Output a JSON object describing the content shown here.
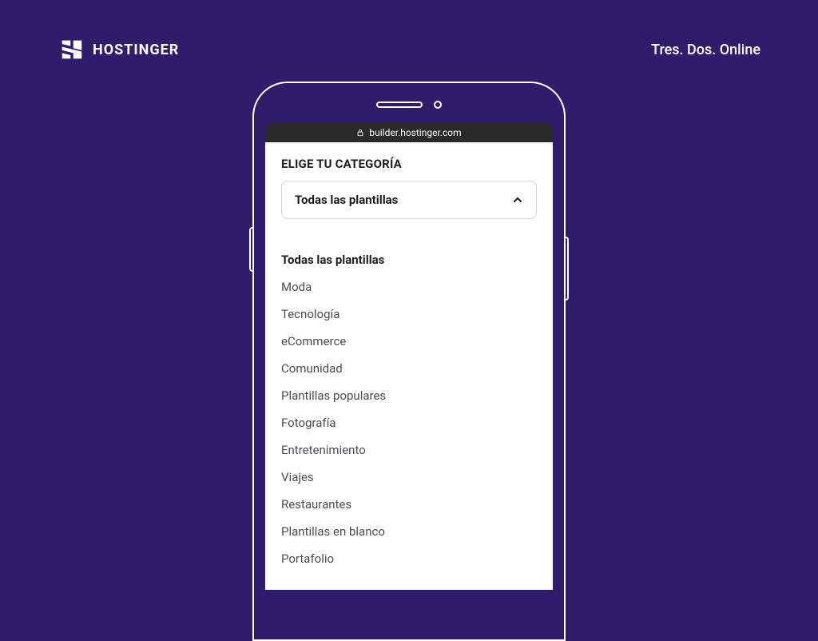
{
  "header": {
    "brand": "HOSTINGER",
    "tagline": "Tres. Dos. Online"
  },
  "browser": {
    "url": "builder.hostinger.com"
  },
  "screen": {
    "heading": "ELIGE TU CATEGORÍA",
    "dropdown_label": "Todas las plantillas",
    "categories": [
      "Todas las plantillas",
      "Moda",
      "Tecnología",
      "eCommerce",
      "Comunidad",
      "Plantillas populares",
      "Fotografía",
      "Entretenimiento",
      "Viajes",
      "Restaurantes",
      "Plantillas en blanco",
      "Portafolio"
    ],
    "active_index": 0
  }
}
